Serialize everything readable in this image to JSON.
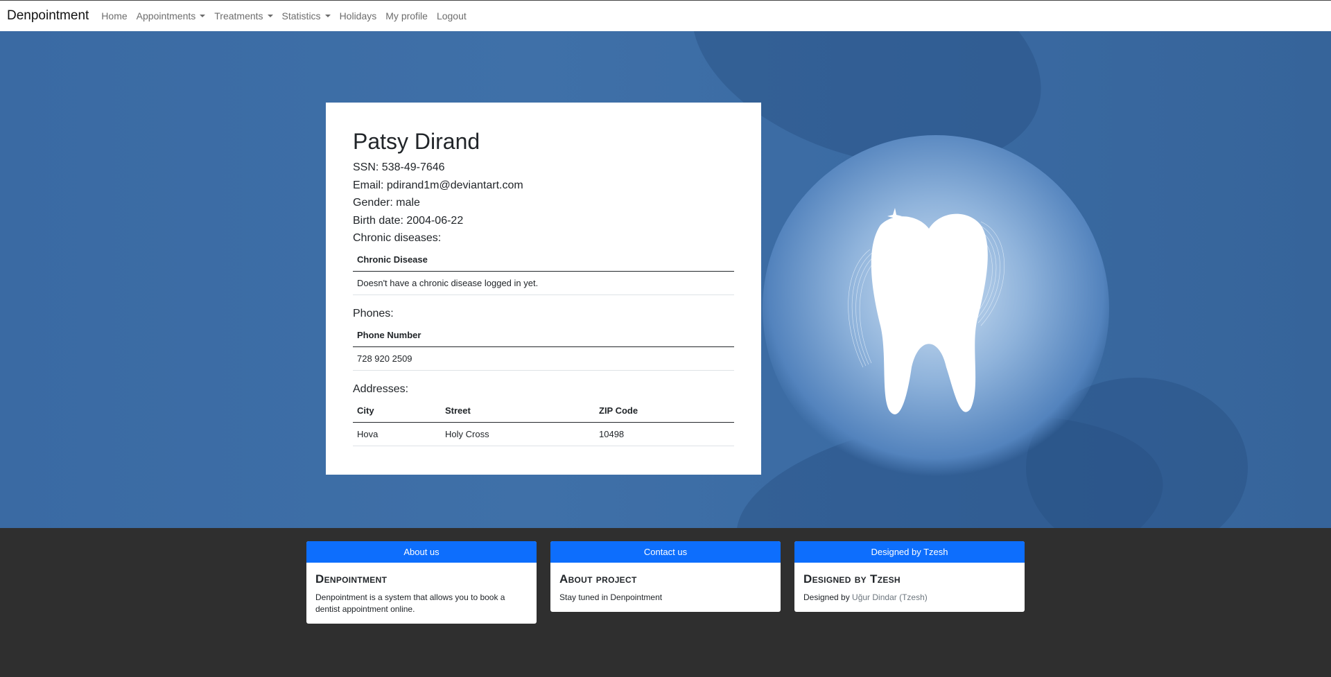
{
  "navbar": {
    "brand": "Denpointment",
    "items": [
      {
        "label": "Home",
        "dropdown": false
      },
      {
        "label": "Appointments",
        "dropdown": true
      },
      {
        "label": "Treatments",
        "dropdown": true
      },
      {
        "label": "Statistics",
        "dropdown": true
      },
      {
        "label": "Holidays",
        "dropdown": false
      },
      {
        "label": "My profile",
        "dropdown": false
      },
      {
        "label": "Logout",
        "dropdown": false
      }
    ]
  },
  "profile": {
    "name": "Patsy Dirand",
    "ssn": "SSN: 538-49-7646",
    "email": "Email: pdirand1m@deviantart.com",
    "gender": "Gender: male",
    "birth_date": "Birth date: 2004-06-22",
    "chronic_label": "Chronic diseases:",
    "chronic_table": {
      "header": "Chronic Disease",
      "rows": [
        "Doesn't have a chronic disease logged in yet."
      ]
    },
    "phones_label": "Phones:",
    "phones_table": {
      "header": "Phone Number",
      "rows": [
        "728 920 2509"
      ]
    },
    "addresses_label": "Addresses:",
    "addresses_table": {
      "headers": [
        "City",
        "Street",
        "ZIP Code"
      ],
      "rows": [
        [
          "Hova",
          "Holy Cross",
          "10498"
        ]
      ]
    }
  },
  "footer": {
    "about": {
      "header": "About us",
      "title": "Denpointment",
      "text": "Denpointment is a system that allows you to book a dentist appointment online."
    },
    "contact": {
      "header": "Contact us",
      "title": "About project",
      "text": "Stay tuned in Denpointment"
    },
    "designed": {
      "header": "Designed by Tzesh",
      "title": "Designed by Tzesh",
      "text_prefix": "Designed by ",
      "link": "Uğur Dindar (Tzesh)"
    }
  },
  "colors": {
    "accent": "#0d6efd",
    "hero": "#3f70a8",
    "footer_bg": "#2f2f2f"
  },
  "icons": {
    "hero_illustration": "tooth-icon",
    "dropdown": "caret-down-icon"
  }
}
